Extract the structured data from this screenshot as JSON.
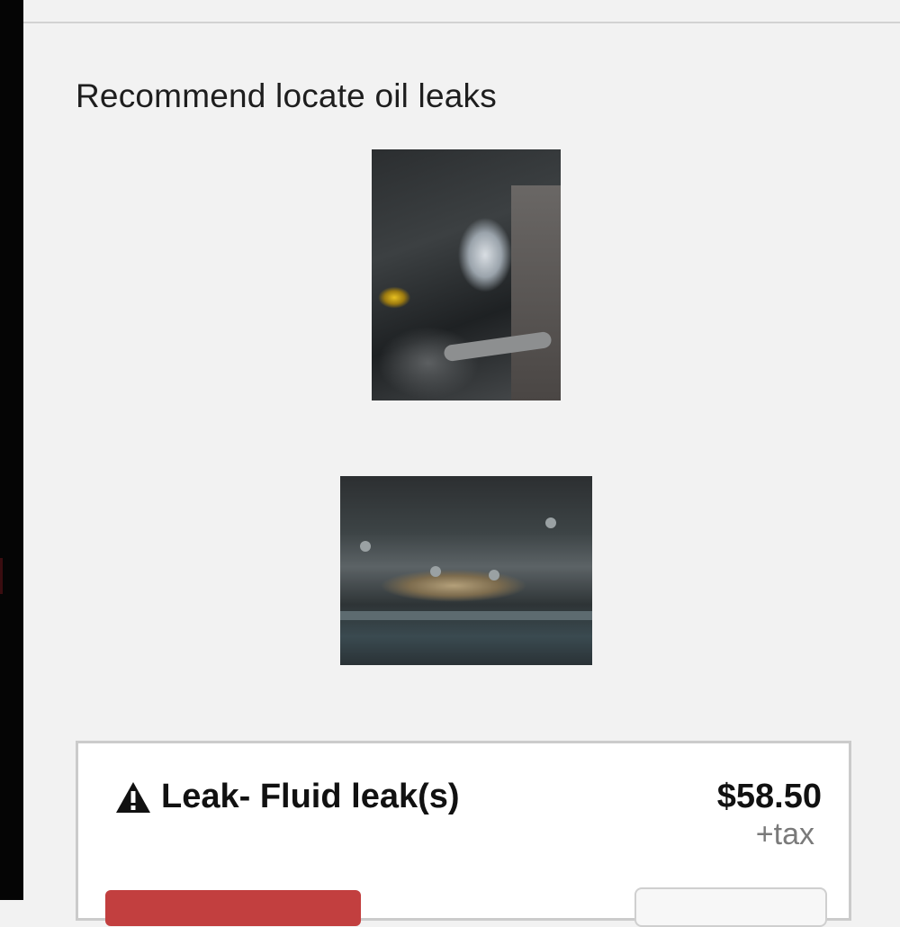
{
  "recommendation": {
    "text": "Recommend locate oil leaks"
  },
  "photos": [
    {
      "subject": "engine-bay-oil-leak-photo"
    },
    {
      "subject": "oil-pan-gasket-photo"
    }
  ],
  "service_card": {
    "icon": "warning-triangle-icon",
    "title": "Leak- Fluid leak(s)",
    "price": "$58.50",
    "tax_note": "+tax",
    "status_badge_color": "#c23f3f"
  },
  "colors": {
    "background": "#f2f2f2",
    "card_border": "#cbcbcb",
    "declined_red": "#c23f3f"
  }
}
